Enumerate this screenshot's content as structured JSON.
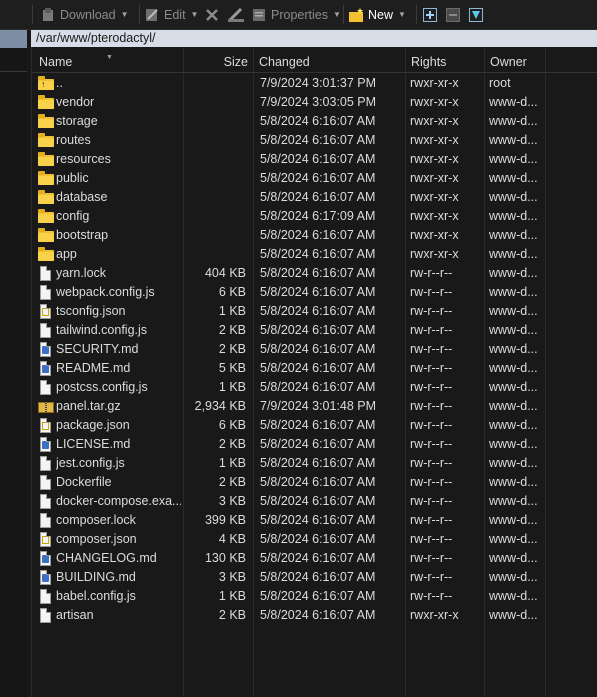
{
  "toolbar": {
    "download_label": "Download",
    "edit_label": "Edit",
    "properties_label": "Properties",
    "new_label": "New"
  },
  "path": "/var/www/pterodactyl/",
  "columns": {
    "name": "Name",
    "size": "Size",
    "changed": "Changed",
    "rights": "Rights",
    "owner": "Owner"
  },
  "rows": [
    {
      "type": "parent",
      "name": "..",
      "size": "",
      "changed": "7/9/2024 3:01:37 PM",
      "rights": "rwxr-xr-x",
      "owner": "root"
    },
    {
      "type": "folder",
      "name": "vendor",
      "size": "",
      "changed": "7/9/2024 3:03:05 PM",
      "rights": "rwxr-xr-x",
      "owner": "www-d..."
    },
    {
      "type": "folder",
      "name": "storage",
      "size": "",
      "changed": "5/8/2024 6:16:07 AM",
      "rights": "rwxr-xr-x",
      "owner": "www-d..."
    },
    {
      "type": "folder",
      "name": "routes",
      "size": "",
      "changed": "5/8/2024 6:16:07 AM",
      "rights": "rwxr-xr-x",
      "owner": "www-d..."
    },
    {
      "type": "folder",
      "name": "resources",
      "size": "",
      "changed": "5/8/2024 6:16:07 AM",
      "rights": "rwxr-xr-x",
      "owner": "www-d..."
    },
    {
      "type": "folder",
      "name": "public",
      "size": "",
      "changed": "5/8/2024 6:16:07 AM",
      "rights": "rwxr-xr-x",
      "owner": "www-d..."
    },
    {
      "type": "folder",
      "name": "database",
      "size": "",
      "changed": "5/8/2024 6:16:07 AM",
      "rights": "rwxr-xr-x",
      "owner": "www-d..."
    },
    {
      "type": "folder",
      "name": "config",
      "size": "",
      "changed": "5/8/2024 6:17:09 AM",
      "rights": "rwxr-xr-x",
      "owner": "www-d..."
    },
    {
      "type": "folder",
      "name": "bootstrap",
      "size": "",
      "changed": "5/8/2024 6:16:07 AM",
      "rights": "rwxr-xr-x",
      "owner": "www-d..."
    },
    {
      "type": "folder",
      "name": "app",
      "size": "",
      "changed": "5/8/2024 6:16:07 AM",
      "rights": "rwxr-xr-x",
      "owner": "www-d..."
    },
    {
      "type": "file",
      "name": "yarn.lock",
      "size": "404 KB",
      "changed": "5/8/2024 6:16:07 AM",
      "rights": "rw-r--r--",
      "owner": "www-d..."
    },
    {
      "type": "file",
      "name": "webpack.config.js",
      "size": "6 KB",
      "changed": "5/8/2024 6:16:07 AM",
      "rights": "rw-r--r--",
      "owner": "www-d..."
    },
    {
      "type": "json",
      "name": "tsconfig.json",
      "size": "1 KB",
      "changed": "5/8/2024 6:16:07 AM",
      "rights": "rw-r--r--",
      "owner": "www-d..."
    },
    {
      "type": "file",
      "name": "tailwind.config.js",
      "size": "2 KB",
      "changed": "5/8/2024 6:16:07 AM",
      "rights": "rw-r--r--",
      "owner": "www-d..."
    },
    {
      "type": "md",
      "name": "SECURITY.md",
      "size": "2 KB",
      "changed": "5/8/2024 6:16:07 AM",
      "rights": "rw-r--r--",
      "owner": "www-d..."
    },
    {
      "type": "md",
      "name": "README.md",
      "size": "5 KB",
      "changed": "5/8/2024 6:16:07 AM",
      "rights": "rw-r--r--",
      "owner": "www-d..."
    },
    {
      "type": "file",
      "name": "postcss.config.js",
      "size": "1 KB",
      "changed": "5/8/2024 6:16:07 AM",
      "rights": "rw-r--r--",
      "owner": "www-d..."
    },
    {
      "type": "archive",
      "name": "panel.tar.gz",
      "size": "2,934 KB",
      "changed": "7/9/2024 3:01:48 PM",
      "rights": "rw-r--r--",
      "owner": "www-d..."
    },
    {
      "type": "json",
      "name": "package.json",
      "size": "6 KB",
      "changed": "5/8/2024 6:16:07 AM",
      "rights": "rw-r--r--",
      "owner": "www-d..."
    },
    {
      "type": "md",
      "name": "LICENSE.md",
      "size": "2 KB",
      "changed": "5/8/2024 6:16:07 AM",
      "rights": "rw-r--r--",
      "owner": "www-d..."
    },
    {
      "type": "file",
      "name": "jest.config.js",
      "size": "1 KB",
      "changed": "5/8/2024 6:16:07 AM",
      "rights": "rw-r--r--",
      "owner": "www-d..."
    },
    {
      "type": "file",
      "name": "Dockerfile",
      "size": "2 KB",
      "changed": "5/8/2024 6:16:07 AM",
      "rights": "rw-r--r--",
      "owner": "www-d..."
    },
    {
      "type": "file",
      "name": "docker-compose.exa...",
      "size": "3 KB",
      "changed": "5/8/2024 6:16:07 AM",
      "rights": "rw-r--r--",
      "owner": "www-d..."
    },
    {
      "type": "file",
      "name": "composer.lock",
      "size": "399 KB",
      "changed": "5/8/2024 6:16:07 AM",
      "rights": "rw-r--r--",
      "owner": "www-d..."
    },
    {
      "type": "json",
      "name": "composer.json",
      "size": "4 KB",
      "changed": "5/8/2024 6:16:07 AM",
      "rights": "rw-r--r--",
      "owner": "www-d..."
    },
    {
      "type": "md",
      "name": "CHANGELOG.md",
      "size": "130 KB",
      "changed": "5/8/2024 6:16:07 AM",
      "rights": "rw-r--r--",
      "owner": "www-d..."
    },
    {
      "type": "md",
      "name": "BUILDING.md",
      "size": "3 KB",
      "changed": "5/8/2024 6:16:07 AM",
      "rights": "rw-r--r--",
      "owner": "www-d..."
    },
    {
      "type": "file",
      "name": "babel.config.js",
      "size": "1 KB",
      "changed": "5/8/2024 6:16:07 AM",
      "rights": "rw-r--r--",
      "owner": "www-d..."
    },
    {
      "type": "file",
      "name": "artisan",
      "size": "2 KB",
      "changed": "5/8/2024 6:16:07 AM",
      "rights": "rwxr-xr-x",
      "owner": "www-d..."
    }
  ]
}
